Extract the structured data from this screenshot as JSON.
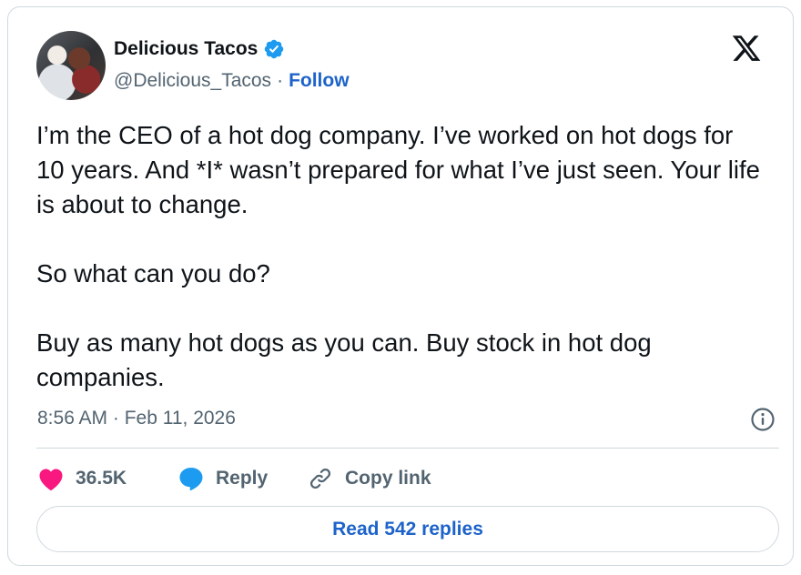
{
  "author": {
    "name": "Delicious Tacos",
    "handle": "@Delicious_Tacos",
    "separator": "·",
    "follow_label": "Follow",
    "verified_color": "#1d9bf0"
  },
  "tweet": {
    "paragraphs": [
      "I’m the CEO of a hot dog company. I’ve worked on hot dogs for 10 years. And *I* wasn’t prepared for what I’ve just seen. Your life is about to change.",
      "So what can you do?",
      "Buy as many hot dogs as you can. Buy stock in hot dog companies."
    ],
    "timestamp": "8:56 AM · Feb 11, 2026"
  },
  "actions": {
    "likes_count": "36.5K",
    "reply_label": "Reply",
    "copy_link_label": "Copy link",
    "like_color": "#f91880",
    "reply_color": "#1d9bf0"
  },
  "read_replies_label": "Read 542 replies",
  "icons": {
    "platform": "x-logo-icon",
    "verified": "verified-badge-icon",
    "info": "info-icon",
    "like": "heart-icon",
    "reply": "speech-bubble-icon",
    "copy_link": "link-icon"
  }
}
